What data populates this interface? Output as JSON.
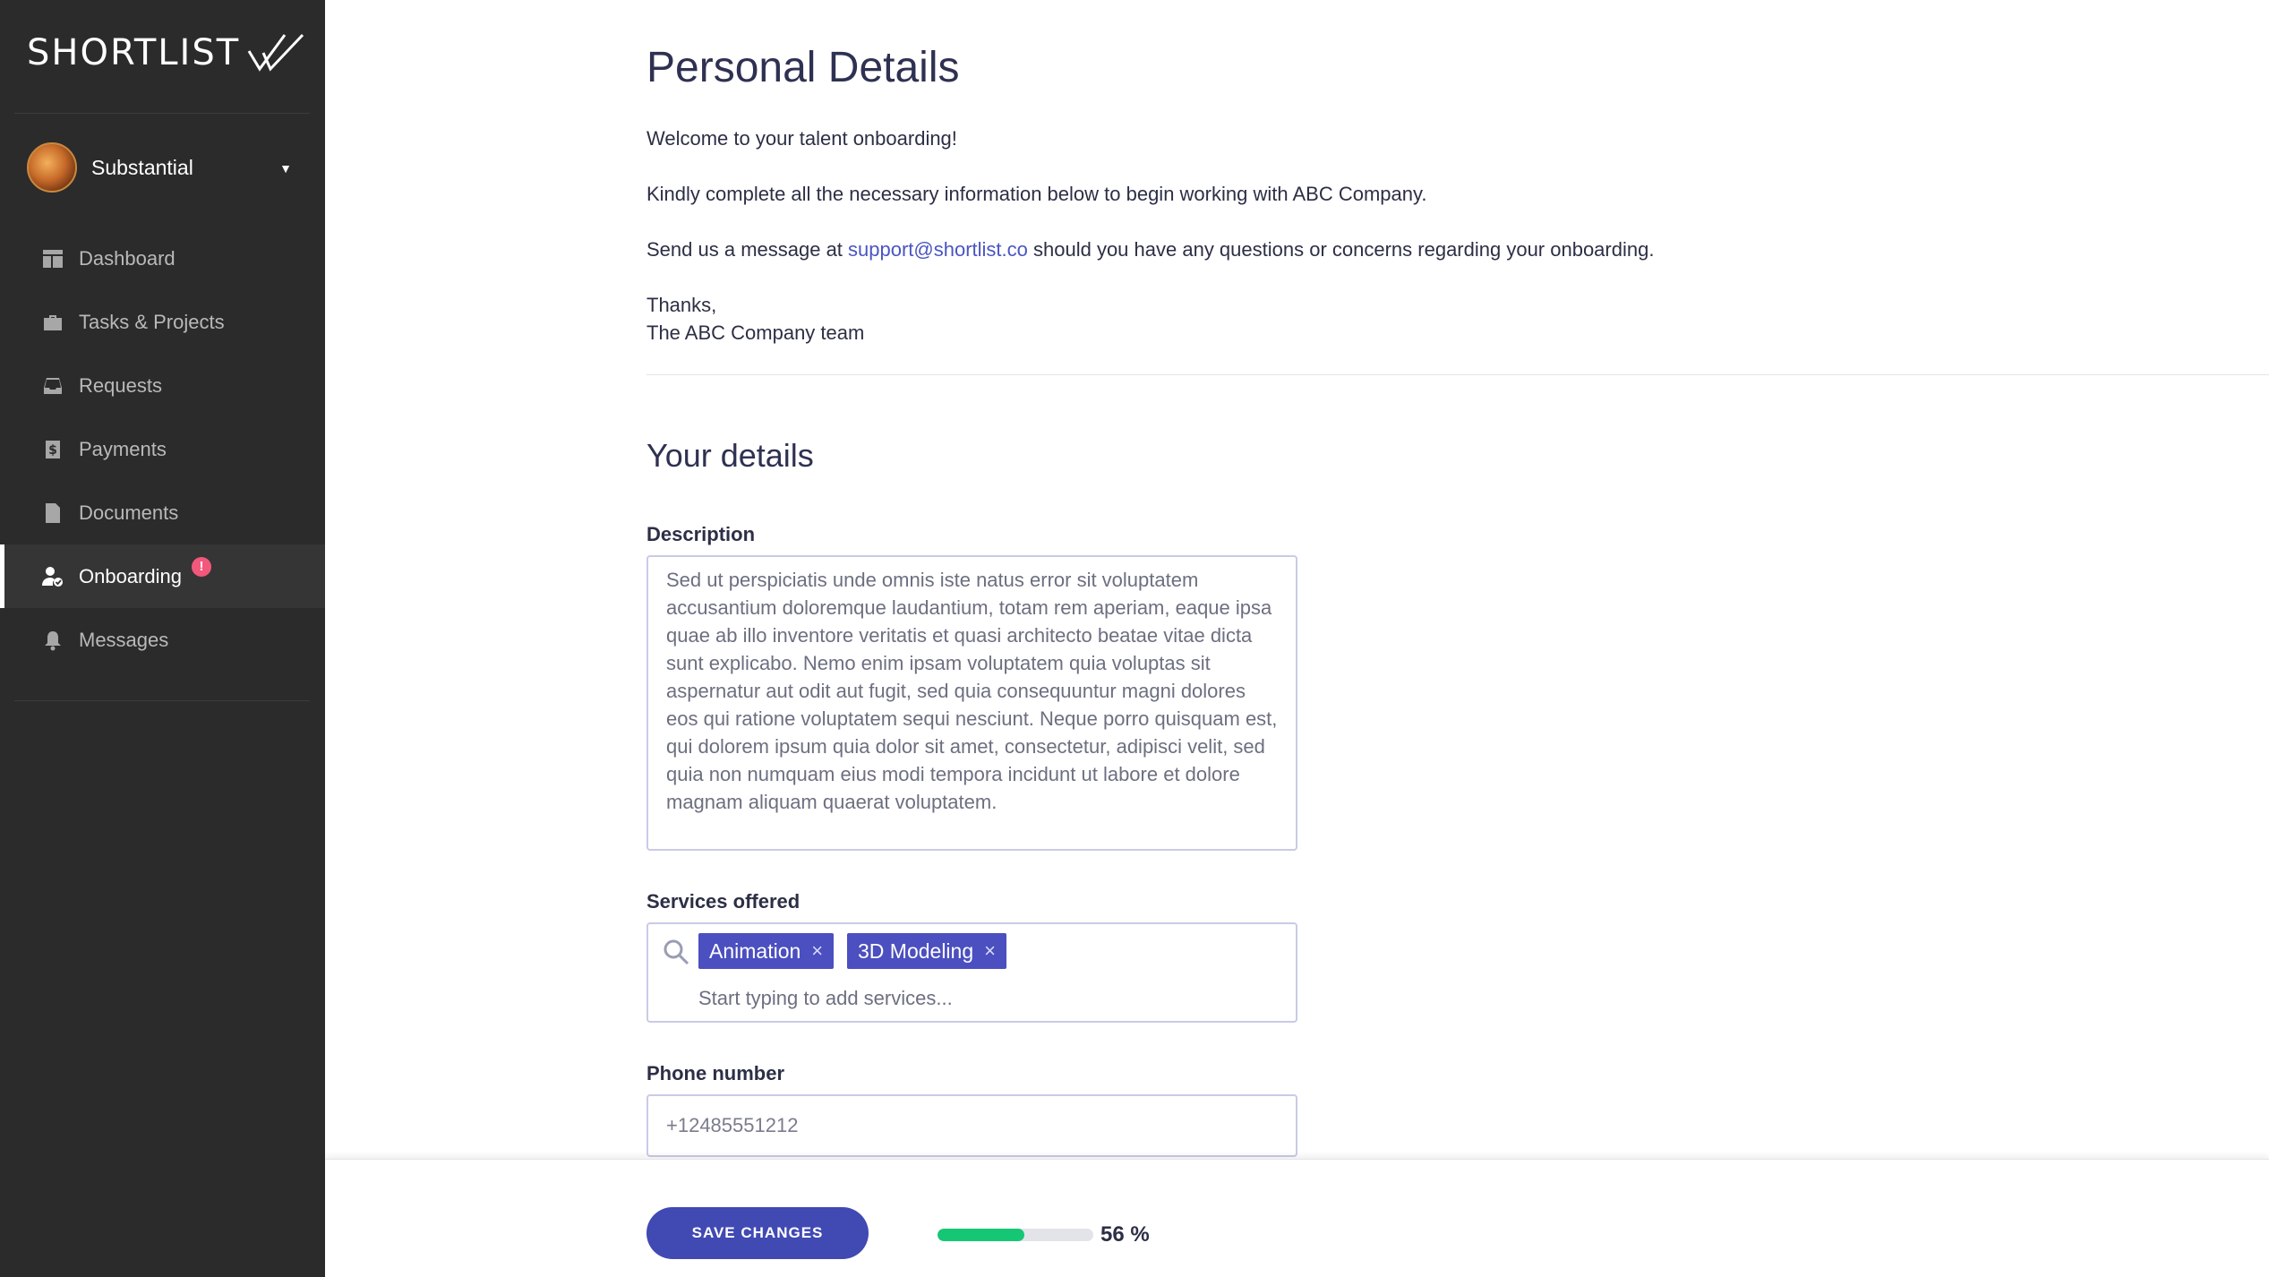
{
  "brand": {
    "name": "SHORTLIST"
  },
  "user": {
    "name": "Substantial"
  },
  "sidebar": {
    "items": [
      {
        "label": "Dashboard",
        "icon": "dashboard-icon"
      },
      {
        "label": "Tasks & Projects",
        "icon": "briefcase-icon"
      },
      {
        "label": "Requests",
        "icon": "inbox-icon"
      },
      {
        "label": "Payments",
        "icon": "dollar-icon"
      },
      {
        "label": "Documents",
        "icon": "document-icon"
      },
      {
        "label": "Onboarding",
        "icon": "user-check-icon",
        "active": true,
        "badge": "!"
      },
      {
        "label": "Messages",
        "icon": "bell-icon"
      }
    ]
  },
  "main": {
    "title": "Personal Details",
    "welcome": "Welcome to your talent onboarding!",
    "instructions": "Kindly complete all the necessary information below to begin working with ABC Company.",
    "contact_prefix": "Send us a message at ",
    "contact_email": "support@shortlist.co",
    "contact_suffix": " should you have any questions or concerns regarding your onboarding.",
    "signoff_1": "Thanks,",
    "signoff_2": "The ABC Company team",
    "section_title": "Your details",
    "description": {
      "label": "Description",
      "value": "Sed ut perspiciatis unde omnis iste natus error sit voluptatem accusantium doloremque laudantium, totam rem aperiam, eaque ipsa quae ab illo inventore veritatis et quasi architecto beatae vitae dicta sunt explicabo. Nemo enim ipsam voluptatem quia voluptas sit aspernatur aut odit aut fugit, sed quia consequuntur magni dolores eos qui ratione voluptatem sequi nesciunt. Neque porro quisquam est, qui dolorem ipsum quia dolor sit amet, consectetur, adipisci velit, sed quia non numquam eius modi tempora incidunt ut labore et dolore magnam aliquam quaerat voluptatem."
    },
    "services": {
      "label": "Services offered",
      "tags": [
        "Animation",
        "3D Modeling"
      ],
      "remove_glyph": "×",
      "placeholder": "Start typing to add services..."
    },
    "phone": {
      "label": "Phone number",
      "placeholder": "+12485551212"
    }
  },
  "footer": {
    "save_label": "SAVE CHANGES",
    "progress_value": 0.56,
    "progress_label": "56 %",
    "progress_color": "#15c774"
  },
  "colors": {
    "sidebar_bg": "#2b2b2b",
    "accent": "#4149b3",
    "badge": "#f2577c",
    "link": "#4a55c2"
  }
}
